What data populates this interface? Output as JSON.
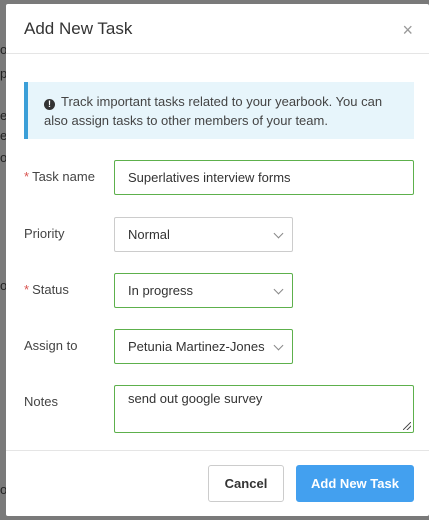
{
  "backdrop": {
    "snippets": [
      "ot",
      "p",
      "ea",
      "ej",
      "op",
      "ou",
      "or"
    ]
  },
  "modal": {
    "title": "Add New Task",
    "close_glyph": "×",
    "info": "Track important tasks related to your yearbook. You can also assign tasks to other members of your team.",
    "info_icon_glyph": "!",
    "form": {
      "required_mark": "*",
      "task_name_label": "Task name",
      "task_name_value": "Superlatives interview forms",
      "priority_label": "Priority",
      "priority_value": "Normal",
      "status_label": "Status",
      "status_value": "In progress",
      "assign_label": "Assign to",
      "assign_value": "Petunia Martinez-Jones",
      "notes_label": "Notes",
      "notes_value": "send out google survey"
    },
    "footer": {
      "cancel_label": "Cancel",
      "add_label": "Add New Task"
    }
  },
  "colors": {
    "accent_button": "#43a0ef",
    "valid_border": "#5db04c",
    "info_border": "#3b9fd8",
    "required": "#d9534f"
  }
}
